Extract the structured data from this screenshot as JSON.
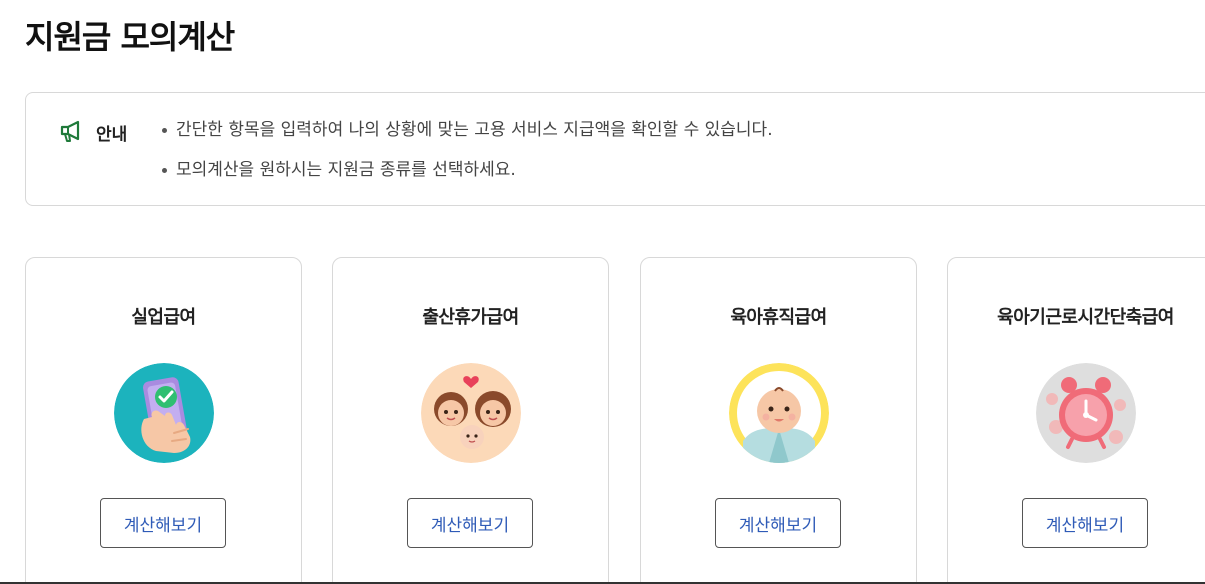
{
  "page": {
    "title": "지원금 모의계산"
  },
  "notice": {
    "label": "안내",
    "icon": "megaphone-icon",
    "items": [
      "간단한 항목을 입력하여 나의 상황에 맞는 고용 서비스 지급액을 확인할 수 있습니다.",
      "모의계산을 원하시는 지원금 종류를 선택하세요."
    ]
  },
  "cards": [
    {
      "title": "실업급여",
      "button_label": "계산해보기",
      "image": "smartphone-check-icon",
      "image_bg": "#1cb3bd"
    },
    {
      "title": "출산휴가급여",
      "button_label": "계산해보기",
      "image": "family-icon",
      "image_bg": "#fcd9b8"
    },
    {
      "title": "육아휴직급여",
      "button_label": "계산해보기",
      "image": "baby-icon",
      "image_bg": "#fde35a"
    },
    {
      "title": "육아기근로시간단축급여",
      "button_label": "계산해보기",
      "image": "alarm-clock-icon",
      "image_bg": "#dedede"
    }
  ],
  "colors": {
    "accent": "#2f5bb7",
    "notice_icon": "#1f7a3a",
    "border": "#d8d8d8"
  }
}
